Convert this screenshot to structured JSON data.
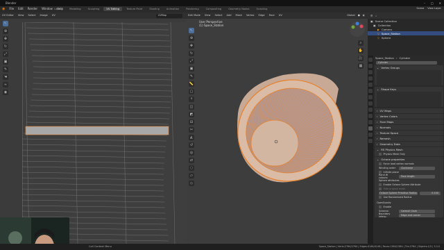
{
  "window": {
    "title": "Blender",
    "controls": [
      "–",
      "□",
      "✕"
    ]
  },
  "menubar": {
    "menus": [
      "File",
      "Edit",
      "Render",
      "Window",
      "Help"
    ],
    "tabs": [
      "Layout",
      "Modeling",
      "Sculpting",
      "UV Editing",
      "Texture Paint",
      "Shading",
      "Animation",
      "Rendering",
      "Compositing",
      "Geometry Nodes",
      "Scripting"
    ],
    "active_tab": "UV Editing",
    "scene": "Scene",
    "view_layer": "View Layer"
  },
  "uv_editor": {
    "header_items": [
      "UV Editor",
      "View",
      "Select",
      "Image",
      "UV"
    ],
    "image_field": "UVMap"
  },
  "viewport": {
    "header_items": [
      "Edit Mode",
      "View",
      "Select",
      "Add",
      "Mesh",
      "Vertex",
      "Edge",
      "Face",
      "UV"
    ],
    "orientation": "Global",
    "info_line1": "User Perspective",
    "info_line2": "(1) Space_Station"
  },
  "outliner": {
    "header": "Scene Collection",
    "items": [
      {
        "label": "Collection",
        "indent": 1
      },
      {
        "label": "Camera",
        "indent": 2
      },
      {
        "label": "Space_Station",
        "indent": 2,
        "selected": true
      },
      {
        "label": "Sphere",
        "indent": 2
      }
    ]
  },
  "properties": {
    "object_name": "Space_Station",
    "mesh_name": "Cylinder",
    "data_field": "Cylinder",
    "panels": {
      "vertex_groups": "Vertex Groups",
      "shape_keys": "Shape Keys",
      "collapsed": [
        "UV Maps",
        "Vertex Colors",
        "Face Maps",
        "Normals",
        "Texture Space",
        "Remesh",
        "Geometry Data",
        "RS Physics Mesh"
      ],
      "physics_mesh_only": "Physics Mesh Only",
      "octane": "Octane properties",
      "force_load": "Force load vertex normals",
      "winding_label": "Winding order:",
      "winding_value": "Clockwise",
      "infinite_plane": "Infinite plane",
      "rand_seed_label": "Rand W colours:",
      "rand_seed_value": "Face length",
      "sphere_attr_header": "Sphere attributes",
      "enable_sphere": "Enable Octane Sphere Attribute",
      "hide_original": "Hide original mesh",
      "radius_label": "Octane Sphere Primitive Radius",
      "radius_value": "0.100",
      "use_randomized": "Use Randomized Radius",
      "open_subdiv": "OpenSubdiv",
      "enable": "Enable",
      "scheme_label": "Scheme:",
      "scheme_value": "Catmull Clark",
      "boundary_label": "Boundary interp.:",
      "boundary_value": "Edge and corner"
    }
  },
  "statusbar": {
    "left": "Call Context Menu",
    "right": "Space_Station | Verts:2764/2764 | Edges:4146/4146 | Faces:1384/1384 | Tris:2764 | Objects:1/3 | 3.0.0"
  }
}
